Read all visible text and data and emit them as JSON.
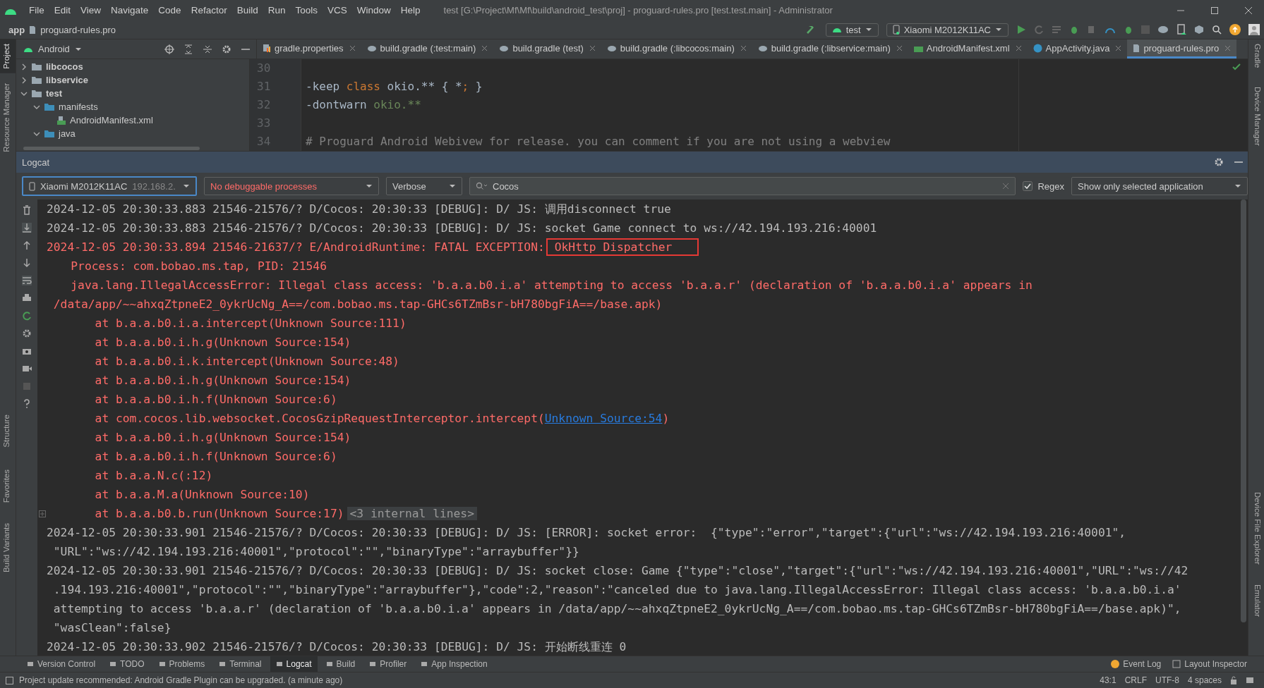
{
  "menu": [
    "File",
    "Edit",
    "View",
    "Navigate",
    "Code",
    "Refactor",
    "Build",
    "Run",
    "Tools",
    "VCS",
    "Window",
    "Help"
  ],
  "window": {
    "title": "test [G:\\Project\\Mf\\Mf\\build\\android_test\\proj] - proguard-rules.pro [test.test.main] - Administrator"
  },
  "breadcrumb": [
    "app",
    "proguard-rules.pro"
  ],
  "run_config": "test",
  "device": "Xiaomi M2012K11AC",
  "project_view": "Android",
  "project_tree": [
    {
      "label": "libcocos",
      "kind": "module",
      "expanded": false
    },
    {
      "label": "libservice",
      "kind": "module",
      "expanded": false
    },
    {
      "label": "test",
      "kind": "module",
      "expanded": true,
      "children": [
        {
          "label": "manifests",
          "kind": "folder",
          "expanded": true,
          "children": [
            {
              "label": "AndroidManifest.xml",
              "kind": "file"
            }
          ]
        },
        {
          "label": "java",
          "kind": "folder",
          "expanded": true
        }
      ]
    }
  ],
  "editor_tabs": [
    {
      "label": "gradle.properties",
      "kind": "properties",
      "selected": false
    },
    {
      "label": "build.gradle (:test:main)",
      "kind": "gradle",
      "selected": false
    },
    {
      "label": "build.gradle (test)",
      "kind": "gradle",
      "selected": false
    },
    {
      "label": "build.gradle (:libcocos:main)",
      "kind": "gradle",
      "selected": false
    },
    {
      "label": "build.gradle (:libservice:main)",
      "kind": "gradle",
      "selected": false
    },
    {
      "label": "AndroidManifest.xml",
      "kind": "manifest",
      "selected": false
    },
    {
      "label": "AppActivity.java",
      "kind": "java",
      "selected": false
    },
    {
      "label": "proguard-rules.pro",
      "kind": "text",
      "selected": true
    }
  ],
  "editor_lines": [
    {
      "number": "30"
    },
    {
      "number": "31",
      "tokens": [
        {
          "text": "-keep ",
          "kind": "plain"
        },
        {
          "text": "class",
          "kind": "keyword"
        },
        {
          "text": " okio.** { *",
          "kind": "plain"
        },
        {
          "text": ";",
          "kind": "keyword"
        },
        {
          "text": " }",
          "kind": "plain"
        }
      ]
    },
    {
      "number": "32",
      "tokens": [
        {
          "text": "-dontwarn ",
          "kind": "plain"
        },
        {
          "text": "okio.**",
          "kind": "green"
        }
      ]
    },
    {
      "number": "33"
    },
    {
      "number": "34",
      "tokens": [
        {
          "text": "# Proguard Android Webivew for release. you can comment if you are not using a webview",
          "kind": "comment"
        }
      ]
    }
  ],
  "logcat": {
    "title": "Logcat",
    "device_filter": {
      "name": "Xiaomi M2012K11AC",
      "address": "192.168.2."
    },
    "process_filter": "No debuggable processes",
    "log_level": "Verbose",
    "search": {
      "value": "Cocos"
    },
    "regex": {
      "label": "Regex",
      "checked": true
    },
    "scope_filter": "Show only selected application",
    "lines": [
      {
        "kind": "entry",
        "color": "#bbbbbb",
        "text": "2024-12-05 20:30:33.883 21546-21576/? D/Cocos: 20:30:33 [DEBUG]: D/ JS: 调用disconnect true"
      },
      {
        "kind": "entry",
        "color": "#bbbbbb",
        "text": "2024-12-05 20:30:33.883 21546-21576/? D/Cocos: 20:30:33 [DEBUG]: D/ JS: socket Game connect to ws://42.194.193.216:40001"
      },
      {
        "kind": "entry",
        "color": "#ff6b68",
        "text": "2024-12-05 20:30:33.894 21546-21637/? E/AndroidRuntime: FATAL EXCEPTION:",
        "boxed": "OkHttp Dispatcher"
      },
      {
        "kind": "detail",
        "color": "#ff6b68",
        "text": "Process: com.bobao.ms.tap, PID: 21546"
      },
      {
        "kind": "detail",
        "color": "#ff6b68",
        "text": "java.lang.IllegalAccessError: Illegal class access: 'b.a.a.b0.i.a' attempting to access 'b.a.a.r' (declaration of 'b.a.a.b0.i.a' appears in"
      },
      {
        "kind": "wrap",
        "color": "#ff6b68",
        "text": "/data/app/~~ahxqZtpneE2_0ykrUcNg_A==/com.bobao.ms.tap-GHCs6TZmBsr-bH780bgFiA==/base.apk)"
      },
      {
        "kind": "frame",
        "color": "#ff6b68",
        "text": "at b.a.a.b0.i.a.intercept(Unknown Source:111)"
      },
      {
        "kind": "frame",
        "color": "#ff6b68",
        "text": "at b.a.a.b0.i.h.g(Unknown Source:154)"
      },
      {
        "kind": "frame",
        "color": "#ff6b68",
        "text": "at b.a.a.b0.i.k.intercept(Unknown Source:48)"
      },
      {
        "kind": "frame",
        "color": "#ff6b68",
        "text": "at b.a.a.b0.i.h.g(Unknown Source:154)"
      },
      {
        "kind": "frame",
        "color": "#ff6b68",
        "text": "at b.a.a.b0.i.h.f(Unknown Source:6)"
      },
      {
        "kind": "frame",
        "color": "#ff6b68",
        "text": "at com.cocos.lib.websocket.CocosGzipRequestInterceptor.intercept(",
        "link": "Unknown Source:54",
        "suffix": ")"
      },
      {
        "kind": "frame",
        "color": "#ff6b68",
        "text": "at b.a.a.b0.i.h.g(Unknown Source:154)"
      },
      {
        "kind": "frame",
        "color": "#ff6b68",
        "text": "at b.a.a.b0.i.h.f(Unknown Source:6)"
      },
      {
        "kind": "frame",
        "color": "#ff6b68",
        "text": "at b.a.a.N.c(:12)"
      },
      {
        "kind": "frame",
        "color": "#ff6b68",
        "text": "at b.a.a.M.a(Unknown Source:10)"
      },
      {
        "kind": "frame",
        "color": "#ff6b68",
        "text": "at b.a.a.b0.b.run(Unknown Source:17)",
        "folded": "<3 internal lines>"
      },
      {
        "kind": "entry",
        "color": "#bbbbbb",
        "text": "2024-12-05 20:30:33.901 21546-21576/? D/Cocos: 20:30:33 [DEBUG]: D/ JS: [ERROR]: socket error:  {\"type\":\"error\",\"target\":{\"url\":\"ws://42.194.193.216:40001\","
      },
      {
        "kind": "wrap",
        "color": "#bbbbbb",
        "text": "\"URL\":\"ws://42.194.193.216:40001\",\"protocol\":\"\",\"binaryType\":\"arraybuffer\"}}"
      },
      {
        "kind": "entry",
        "color": "#bbbbbb",
        "text": "2024-12-05 20:30:33.901 21546-21576/? D/Cocos: 20:30:33 [DEBUG]: D/ JS: socket close: Game {\"type\":\"close\",\"target\":{\"url\":\"ws://42.194.193.216:40001\",\"URL\":\"ws://42"
      },
      {
        "kind": "wrap",
        "color": "#bbbbbb",
        "text": ".194.193.216:40001\",\"protocol\":\"\",\"binaryType\":\"arraybuffer\"},\"code\":2,\"reason\":\"canceled due to java.lang.IllegalAccessError: Illegal class access: 'b.a.a.b0.i.a'"
      },
      {
        "kind": "wrap",
        "color": "#bbbbbb",
        "text": "attempting to access 'b.a.a.r' (declaration of 'b.a.a.b0.i.a' appears in /data/app/~~ahxqZtpneE2_0ykrUcNg_A==/com.bobao.ms.tap-GHCs6TZmBsr-bH780bgFiA==/base.apk)\","
      },
      {
        "kind": "wrap",
        "color": "#bbbbbb",
        "text": "\"wasClean\":false}"
      },
      {
        "kind": "entry",
        "color": "#bbbbbb",
        "text": "2024-12-05 20:30:33.902 21546-21576/? D/Cocos: 20:30:33 [DEBUG]: D/ JS: 开始断线重连 0"
      }
    ]
  },
  "left_strip": [
    {
      "label": "Project",
      "selected": true
    },
    {
      "label": "Resource Manager",
      "selected": false
    },
    {
      "label": "Structure",
      "selected": false
    },
    {
      "label": "Favorites",
      "selected": false
    },
    {
      "label": "Build Variants",
      "selected": false
    }
  ],
  "right_strip": [
    {
      "label": "Gradle",
      "selected": false
    },
    {
      "label": "Device Manager",
      "selected": false
    },
    {
      "label": "Device File Explorer",
      "selected": false
    },
    {
      "label": "Emulator",
      "selected": false
    }
  ],
  "tool_tabs": [
    {
      "label": "Version Control",
      "selected": false
    },
    {
      "label": "TODO",
      "selected": false
    },
    {
      "label": "Problems",
      "selected": false
    },
    {
      "label": "Terminal",
      "selected": false
    },
    {
      "label": "Logcat",
      "selected": true
    },
    {
      "label": "Build",
      "selected": false
    },
    {
      "label": "Profiler",
      "selected": false
    },
    {
      "label": "App Inspection",
      "selected": false
    }
  ],
  "tool_tabs_right": [
    "Event Log",
    "Layout Inspector"
  ],
  "status_bar": {
    "message": "Project update recommended: Android Gradle Plugin can be upgraded. (a minute ago)",
    "items": [
      "43:1",
      "CRLF",
      "UTF-8",
      "4 spaces"
    ]
  }
}
